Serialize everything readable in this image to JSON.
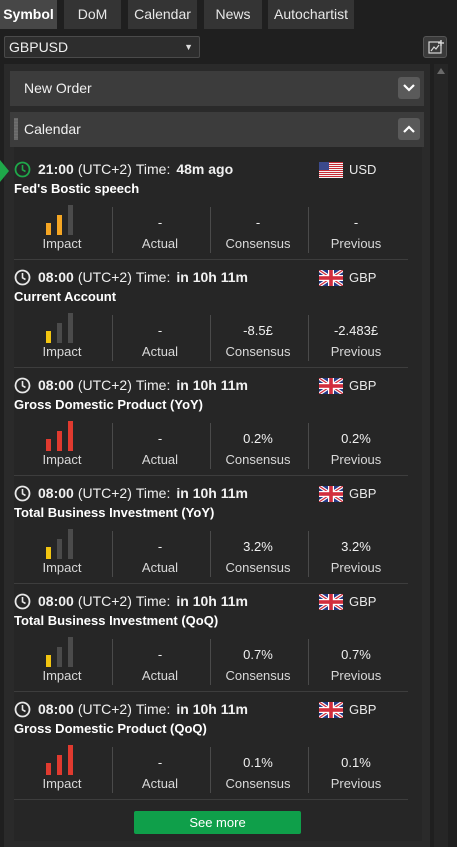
{
  "tabs": [
    {
      "label": "Symbol",
      "active": true
    },
    {
      "label": "DoM",
      "active": false
    },
    {
      "label": "Calendar",
      "active": false
    },
    {
      "label": "News",
      "active": false
    },
    {
      "label": "Autochartist",
      "active": false
    }
  ],
  "symbol": {
    "value": "GBPUSD"
  },
  "panels": {
    "new_order": "New Order",
    "calendar": "Calendar"
  },
  "stat_labels": {
    "impact": "Impact",
    "actual": "Actual",
    "consensus": "Consensus",
    "previous": "Previous"
  },
  "labels": {
    "time": "Time:"
  },
  "colors": {
    "accent_green": "#1fa84a",
    "impact_orange": "#f5a623",
    "impact_yellow": "#f2c511",
    "impact_red": "#e03a2f",
    "impact_inactive": "#4b4b4b"
  },
  "events": [
    {
      "current": true,
      "time": "21:00",
      "tz": "(UTC+2)",
      "time_value": "48m ago",
      "name": "Fed's Bostic speech",
      "flag": "us-flag",
      "currency": "USD",
      "impact_level": 2,
      "impact_color": "#f5a623",
      "actual": "-",
      "consensus": "-",
      "previous": "-"
    },
    {
      "current": false,
      "time": "08:00",
      "tz": "(UTC+2)",
      "time_value": "in 10h 11m",
      "name": "Current Account",
      "flag": "uk-flag",
      "currency": "GBP",
      "impact_level": 1,
      "impact_color": "#f2c511",
      "actual": "-",
      "consensus": "-8.5£",
      "previous": "-2.483£"
    },
    {
      "current": false,
      "time": "08:00",
      "tz": "(UTC+2)",
      "time_value": "in 10h 11m",
      "name": "Gross Domestic Product (YoY)",
      "flag": "uk-flag",
      "currency": "GBP",
      "impact_level": 3,
      "impact_color": "#e03a2f",
      "actual": "-",
      "consensus": "0.2%",
      "previous": "0.2%"
    },
    {
      "current": false,
      "time": "08:00",
      "tz": "(UTC+2)",
      "time_value": "in 10h 11m",
      "name": "Total Business Investment (YoY)",
      "flag": "uk-flag",
      "currency": "GBP",
      "impact_level": 1,
      "impact_color": "#f2c511",
      "actual": "-",
      "consensus": "3.2%",
      "previous": "3.2%"
    },
    {
      "current": false,
      "time": "08:00",
      "tz": "(UTC+2)",
      "time_value": "in 10h 11m",
      "name": "Total Business Investment (QoQ)",
      "flag": "uk-flag",
      "currency": "GBP",
      "impact_level": 1,
      "impact_color": "#f2c511",
      "actual": "-",
      "consensus": "0.7%",
      "previous": "0.7%"
    },
    {
      "current": false,
      "time": "08:00",
      "tz": "(UTC+2)",
      "time_value": "in 10h 11m",
      "name": "Gross Domestic Product (QoQ)",
      "flag": "uk-flag",
      "currency": "GBP",
      "impact_level": 3,
      "impact_color": "#e03a2f",
      "actual": "-",
      "consensus": "0.1%",
      "previous": "0.1%"
    }
  ],
  "see_more": "See more"
}
